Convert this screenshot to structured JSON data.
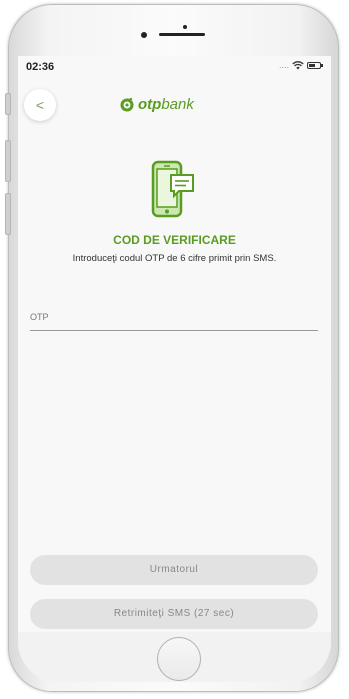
{
  "status_bar": {
    "time": "02:36",
    "signal_dots": "....",
    "wifi_icon": "wifi-icon",
    "battery_icon": "battery-icon"
  },
  "header": {
    "back_label": "<",
    "logo_bold": "otp",
    "logo_light": "bank",
    "brand_color": "#5a9b22"
  },
  "main": {
    "illustration_icon": "phone-sms-icon",
    "title": "COD DE VERIFICARE",
    "subtitle": "Introduceţi codul OTP de 6 cifre primit prin SMS.",
    "otp_label": "OTP",
    "otp_value": ""
  },
  "buttons": {
    "next_label": "Urmatorul",
    "resend_label": "Retrimiteţi SMS (27 sec)"
  }
}
